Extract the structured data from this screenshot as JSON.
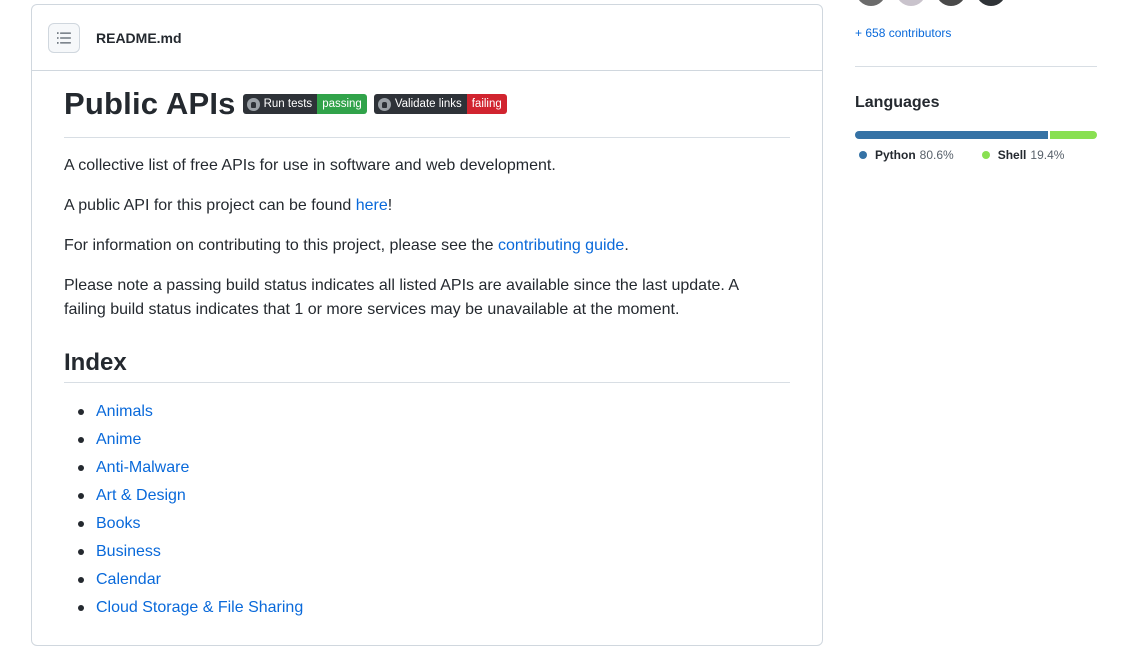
{
  "readme": {
    "filename": "README.md",
    "title": "Public APIs",
    "badges": [
      {
        "label": "Run tests",
        "status": "passing",
        "color": "#31a34a"
      },
      {
        "label": "Validate links",
        "status": "failing",
        "color": "#d1242f"
      }
    ],
    "intro": "A collective list of free APIs for use in software and web development.",
    "api_line": {
      "before": "A public API for this project can be found ",
      "link": "here",
      "after": "!"
    },
    "contrib_line": {
      "before": "For information on contributing to this project, please see the ",
      "link": "contributing guide",
      "after": "."
    },
    "note_line1": "Please note a passing build status indicates all listed APIs are available since the last update. A",
    "note_line2": "failing build status indicates that 1 or more services may be unavailable at the moment.",
    "index_heading": "Index",
    "index_items": [
      "Animals",
      "Anime",
      "Anti-Malware",
      "Art & Design",
      "Books",
      "Business",
      "Calendar",
      "Cloud Storage & File Sharing"
    ]
  },
  "sidebar": {
    "contributors_link": "+ 658 contributors",
    "languages_title": "Languages",
    "languages": [
      {
        "name": "Python",
        "percent": "80.6%",
        "value": 80.6,
        "color": "#3572A5"
      },
      {
        "name": "Shell",
        "percent": "19.4%",
        "value": 19.4,
        "color": "#89e051"
      }
    ]
  }
}
